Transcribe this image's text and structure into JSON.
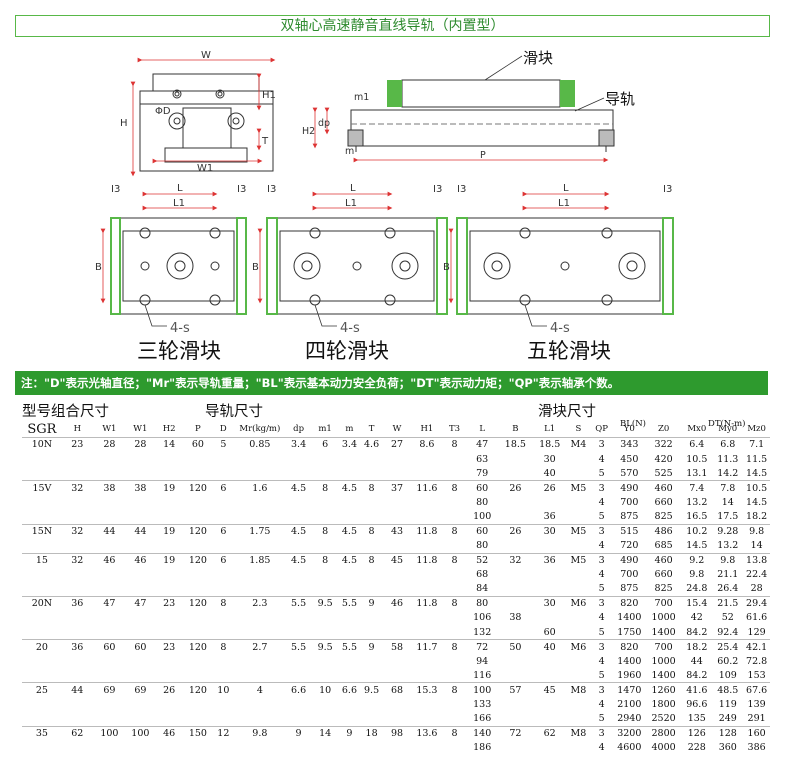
{
  "title": "双轴心高速静音直线导轨（内置型）",
  "labels": {
    "slider": "滑块",
    "rail": "导轨",
    "three": "三轮滑块",
    "four": "四轮滑块",
    "five": "五轮滑块",
    "four_s": "4-s",
    "W": "W",
    "W1": "W1",
    "H": "H",
    "H1": "H1",
    "T": "T",
    "D": "ΦD",
    "m1": "m1",
    "m": "m",
    "H2": "H2",
    "dp": "dp",
    "P": "P",
    "L": "L",
    "L1": "L1",
    "I3": "I3",
    "B": "B"
  },
  "note": "注：\"D\"表示光轴直径；\"Mr\"表示导轨重量；\"BL\"表示基本动力安全负荷；\"DT\"表示动力矩；\"QP\"表示轴承个数。",
  "groups": {
    "model": "型号组合尺寸",
    "rail": "导轨尺寸",
    "slider": "滑块尺寸"
  },
  "headers": [
    "SGR",
    "H",
    "W1",
    "W1",
    "H2",
    "P",
    "D",
    "Mr(kg/m)",
    "dp",
    "m1",
    "m",
    "T",
    "W",
    "H1",
    "T3",
    "L",
    "B",
    "L1",
    "S",
    "QP",
    "Y0",
    "Z0",
    "Mx0",
    "My0",
    "Mz0"
  ],
  "subheaders": {
    "BL": "BL(N)",
    "DT": "DT(N-m)"
  },
  "rows": [
    [
      "10N",
      "23",
      "28",
      "28",
      "14",
      "60",
      "5",
      "0.85",
      "3.4",
      "6",
      "3.4",
      "4.6",
      "27",
      "8.6",
      "8",
      "47",
      "18.5",
      "18.5",
      "M4",
      "3",
      "343",
      "322",
      "6.4",
      "6.8",
      "7.1"
    ],
    [
      "",
      "",
      "",
      "",
      "",
      "",
      "",
      "",
      "",
      "",
      "",
      "",
      "",
      "",
      "",
      "63",
      "",
      "30",
      "",
      "4",
      "450",
      "420",
      "10.5",
      "11.3",
      "11.5"
    ],
    [
      "",
      "",
      "",
      "",
      "",
      "",
      "",
      "",
      "",
      "",
      "",
      "",
      "",
      "",
      "",
      "79",
      "",
      "40",
      "",
      "5",
      "570",
      "525",
      "13.1",
      "14.2",
      "14.5"
    ],
    [
      "15V",
      "32",
      "38",
      "38",
      "19",
      "120",
      "6",
      "1.6",
      "4.5",
      "8",
      "4.5",
      "8",
      "37",
      "11.6",
      "8",
      "60",
      "26",
      "26",
      "M5",
      "3",
      "490",
      "460",
      "7.4",
      "7.8",
      "10.5"
    ],
    [
      "",
      "",
      "",
      "",
      "",
      "",
      "",
      "",
      "",
      "",
      "",
      "",
      "",
      "",
      "",
      "80",
      "",
      "",
      "",
      "4",
      "700",
      "660",
      "13.2",
      "14",
      "14.5"
    ],
    [
      "",
      "",
      "",
      "",
      "",
      "",
      "",
      "",
      "",
      "",
      "",
      "",
      "",
      "",
      "",
      "100",
      "",
      "36",
      "",
      "5",
      "875",
      "825",
      "16.5",
      "17.5",
      "18.2"
    ],
    [
      "15N",
      "32",
      "44",
      "44",
      "19",
      "120",
      "6",
      "1.75",
      "4.5",
      "8",
      "4.5",
      "8",
      "43",
      "11.8",
      "8",
      "60",
      "26",
      "30",
      "M5",
      "3",
      "515",
      "486",
      "10.2",
      "9.28",
      "9.8"
    ],
    [
      "",
      "",
      "",
      "",
      "",
      "",
      "",
      "",
      "",
      "",
      "",
      "",
      "",
      "",
      "",
      "80",
      "",
      "",
      "",
      "4",
      "720",
      "685",
      "14.5",
      "13.2",
      "14"
    ],
    [
      "15",
      "32",
      "46",
      "46",
      "19",
      "120",
      "6",
      "1.85",
      "4.5",
      "8",
      "4.5",
      "8",
      "45",
      "11.8",
      "8",
      "52",
      "32",
      "36",
      "M5",
      "3",
      "490",
      "460",
      "9.2",
      "9.8",
      "13.8"
    ],
    [
      "",
      "",
      "",
      "",
      "",
      "",
      "",
      "",
      "",
      "",
      "",
      "",
      "",
      "",
      "",
      "68",
      "",
      "",
      "",
      "4",
      "700",
      "660",
      "9.8",
      "21.1",
      "22.4"
    ],
    [
      "",
      "",
      "",
      "",
      "",
      "",
      "",
      "",
      "",
      "",
      "",
      "",
      "",
      "",
      "",
      "84",
      "",
      "",
      "",
      "5",
      "875",
      "825",
      "24.8",
      "26.4",
      "28"
    ],
    [
      "20N",
      "36",
      "47",
      "47",
      "23",
      "120",
      "8",
      "2.3",
      "5.5",
      "9.5",
      "5.5",
      "9",
      "46",
      "11.8",
      "8",
      "80",
      "",
      "30",
      "M6",
      "3",
      "820",
      "700",
      "15.4",
      "21.5",
      "29.4"
    ],
    [
      "",
      "",
      "",
      "",
      "",
      "",
      "",
      "",
      "",
      "",
      "",
      "",
      "",
      "",
      "",
      "106",
      "38",
      "",
      "",
      "4",
      "1400",
      "1000",
      "42",
      "52",
      "61.6"
    ],
    [
      "",
      "",
      "",
      "",
      "",
      "",
      "",
      "",
      "",
      "",
      "",
      "",
      "",
      "",
      "",
      "132",
      "",
      "60",
      "",
      "5",
      "1750",
      "1400",
      "84.2",
      "92.4",
      "129"
    ],
    [
      "20",
      "36",
      "60",
      "60",
      "23",
      "120",
      "8",
      "2.7",
      "5.5",
      "9.5",
      "5.5",
      "9",
      "58",
      "11.7",
      "8",
      "72",
      "50",
      "40",
      "M6",
      "3",
      "820",
      "700",
      "18.2",
      "25.4",
      "42.1"
    ],
    [
      "",
      "",
      "",
      "",
      "",
      "",
      "",
      "",
      "",
      "",
      "",
      "",
      "",
      "",
      "",
      "94",
      "",
      "",
      "",
      "4",
      "1400",
      "1000",
      "44",
      "60.2",
      "72.8"
    ],
    [
      "",
      "",
      "",
      "",
      "",
      "",
      "",
      "",
      "",
      "",
      "",
      "",
      "",
      "",
      "",
      "116",
      "",
      "",
      "",
      "5",
      "1960",
      "1400",
      "84.2",
      "109",
      "153"
    ],
    [
      "25",
      "44",
      "69",
      "69",
      "26",
      "120",
      "10",
      "4",
      "6.6",
      "10",
      "6.6",
      "9.5",
      "68",
      "15.3",
      "8",
      "100",
      "57",
      "45",
      "M8",
      "3",
      "1470",
      "1260",
      "41.6",
      "48.5",
      "67.6"
    ],
    [
      "",
      "",
      "",
      "",
      "",
      "",
      "",
      "",
      "",
      "",
      "",
      "",
      "",
      "",
      "",
      "133",
      "",
      "",
      "",
      "4",
      "2100",
      "1800",
      "96.6",
      "119",
      "139"
    ],
    [
      "",
      "",
      "",
      "",
      "",
      "",
      "",
      "",
      "",
      "",
      "",
      "",
      "",
      "",
      "",
      "166",
      "",
      "",
      "",
      "5",
      "2940",
      "2520",
      "135",
      "249",
      "291"
    ],
    [
      "35",
      "62",
      "100",
      "100",
      "46",
      "150",
      "12",
      "9.8",
      "9",
      "14",
      "9",
      "18",
      "98",
      "13.6",
      "8",
      "140",
      "72",
      "62",
      "M8",
      "3",
      "3200",
      "2800",
      "126",
      "128",
      "160"
    ],
    [
      "",
      "",
      "",
      "",
      "",
      "",
      "",
      "",
      "",
      "",
      "",
      "",
      "",
      "",
      "",
      "186",
      "",
      "",
      "",
      "4",
      "4600",
      "4000",
      "228",
      "360",
      "386"
    ]
  ]
}
